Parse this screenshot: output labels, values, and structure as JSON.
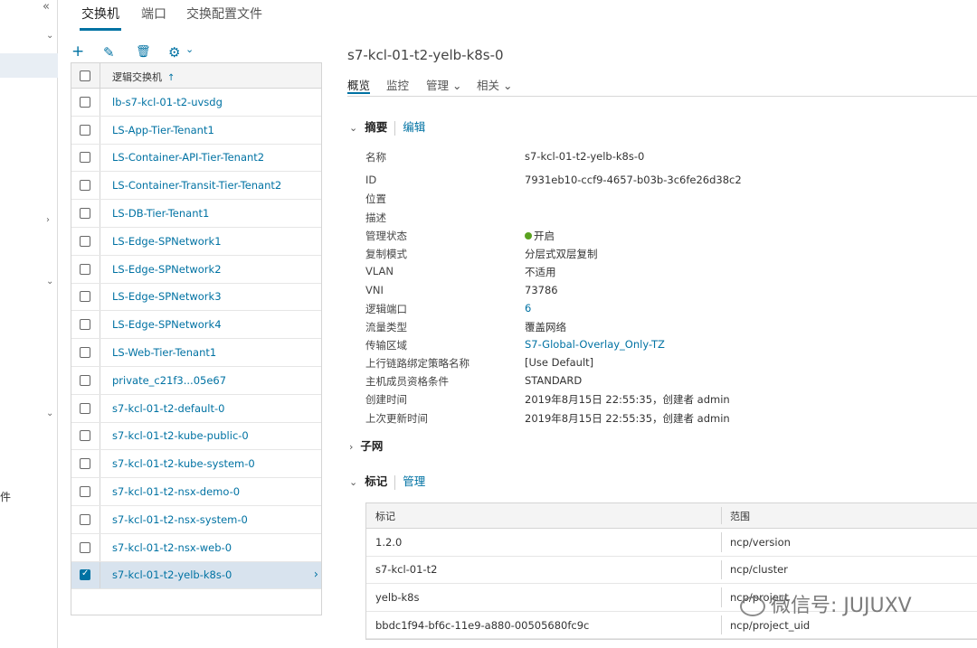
{
  "nav": {
    "collapse": "«",
    "cut_text": "件"
  },
  "top_tabs": [
    "交换机",
    "端口",
    "交换配置文件"
  ],
  "toolbar": {
    "add": "+",
    "edit": "✎",
    "delete": "🗑",
    "gear": "⚙",
    "gear_caret": "⌄"
  },
  "list": {
    "header": "逻辑交换机",
    "sort": "↑",
    "rows": [
      "lb-s7-kcl-01-t2-uvsdg",
      "LS-App-Tier-Tenant1",
      "LS-Container-API-Tier-Tenant2",
      "LS-Container-Transit-Tier-Tenant2",
      "LS-DB-Tier-Tenant1",
      "LS-Edge-SPNetwork1",
      "LS-Edge-SPNetwork2",
      "LS-Edge-SPNetwork3",
      "LS-Edge-SPNetwork4",
      "LS-Web-Tier-Tenant1",
      "private_c21f3...05e67",
      "s7-kcl-01-t2-default-0",
      "s7-kcl-01-t2-kube-public-0",
      "s7-kcl-01-t2-kube-system-0",
      "s7-kcl-01-t2-nsx-demo-0",
      "s7-kcl-01-t2-nsx-system-0",
      "s7-kcl-01-t2-nsx-web-0",
      "s7-kcl-01-t2-yelb-k8s-0"
    ],
    "selected_arrow": "›"
  },
  "detail": {
    "title": "s7-kcl-01-t2-yelb-k8s-0",
    "tabs": [
      "概览",
      "监控",
      "管理 ⌄",
      "相关 ⌄"
    ],
    "summary": {
      "caret": "⌄",
      "label": "摘要",
      "edit": "编辑"
    },
    "props": [
      {
        "k": "名称",
        "v": "s7-kcl-01-t2-yelb-k8s-0"
      },
      {
        "k": "ID",
        "v": "7931eb10-ccf9-4657-b03b-3c6fe26d38c2"
      },
      {
        "k": "位置",
        "v": ""
      },
      {
        "k": "描述",
        "v": ""
      },
      {
        "k": "管理状态",
        "v": "开启"
      },
      {
        "k": "复制模式",
        "v": "分层式双层复制"
      },
      {
        "k": "VLAN",
        "v": "不适用"
      },
      {
        "k": "VNI",
        "v": "73786"
      },
      {
        "k": "逻辑端口",
        "v": "6"
      },
      {
        "k": "流量类型",
        "v": "覆盖网络"
      },
      {
        "k": "传输区域",
        "v": "S7-Global-Overlay_Only-TZ"
      },
      {
        "k": "上行链路绑定策略名称",
        "v": "[Use Default]"
      },
      {
        "k": "主机成员资格条件",
        "v": "STANDARD"
      },
      {
        "k": "创建时间",
        "v": "2019年8月15日 22:55:35，创建者 admin"
      },
      {
        "k": "上次更新时间",
        "v": "2019年8月15日 22:55:35，创建者 admin"
      }
    ],
    "subnet": {
      "caret": "›",
      "label": "子网"
    },
    "tags": {
      "caret": "⌄",
      "label": "标记",
      "manage": "管理"
    },
    "tag_table": {
      "headers": [
        "标记",
        "范围"
      ],
      "rows": [
        [
          "1.2.0",
          "ncp/version"
        ],
        [
          "s7-kcl-01-t2",
          "ncp/cluster"
        ],
        [
          "yelb-k8s",
          "ncp/project"
        ],
        [
          "bbdc1f94-bf6c-11e9-a880-00505680fc9c",
          "ncp/project_uid"
        ]
      ]
    }
  },
  "watermark": "微信号: JUJUXV",
  "colors": {
    "link": "#0072a3",
    "status_on": "#5aa220",
    "selected_row": "#d8e3ee"
  }
}
